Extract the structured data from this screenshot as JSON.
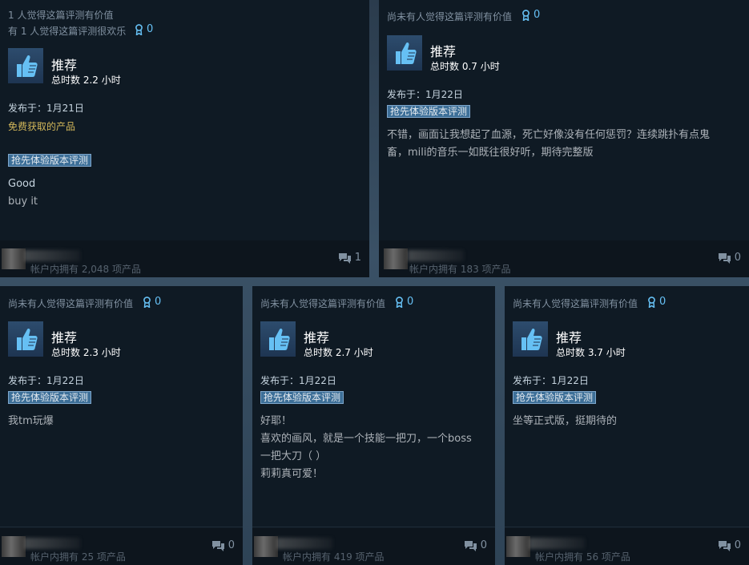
{
  "reviews": [
    {
      "helpful_line1": "1 人觉得这篇评测有价值",
      "helpful_line2": "有 1 人觉得这篇评测很欢乐",
      "award_count": "0",
      "verdict": "推荐",
      "hours": "总时数 2.2 小时",
      "posted": "发布于：1月21日",
      "free_label": "免费获取的产品",
      "early_access": "抢先体验版本评测",
      "body": [
        "Good",
        "buy it"
      ],
      "owned": "帐户内拥有 2,048 项产品",
      "comment_count": "1"
    },
    {
      "helpful_line1": "尚未有人觉得这篇评测有价值",
      "award_count": "0",
      "verdict": "推荐",
      "hours": "总时数 0.7 小时",
      "posted": "发布于：1月22日",
      "early_access": "抢先体验版本评测",
      "body": [
        "不错，画面让我想起了血源，死亡好像没有任何惩罚？连续跳扑有点鬼",
        "畜，mili的音乐一如既往很好听，期待完整版"
      ],
      "owned": "帐户内拥有 183 项产品",
      "comment_count": "0"
    },
    {
      "helpful_line1": "尚未有人觉得这篇评测有价值",
      "award_count": "0",
      "verdict": "推荐",
      "hours": "总时数 2.3 小时",
      "posted": "发布于：1月22日",
      "early_access": "抢先体验版本评测",
      "body": [
        "我tm玩爆"
      ],
      "owned": "帐户内拥有 25 项产品",
      "comment_count": "0"
    },
    {
      "helpful_line1": "尚未有人觉得这篇评测有价值",
      "award_count": "0",
      "verdict": "推荐",
      "hours": "总时数 2.7 小时",
      "posted": "发布于：1月22日",
      "early_access": "抢先体验版本评测",
      "body": [
        "好耶！",
        "喜欢的画风，就是一个技能一把刀，一个boss",
        "一把大刀（ ）",
        "莉莉真可爱！"
      ],
      "owned": "帐户内拥有 419 项产品",
      "comment_count": "0"
    },
    {
      "helpful_line1": "尚未有人觉得这篇评测有价值",
      "award_count": "0",
      "verdict": "推荐",
      "hours": "总时数 3.7 小时",
      "posted": "发布于：1月22日",
      "early_access": "抢先体验版本评测",
      "body": [
        "坐等正式版，挺期待的"
      ],
      "owned": "帐户内拥有 56 项产品",
      "comment_count": "0"
    }
  ],
  "colors": {
    "card_bg": "#0f1a24",
    "accent_blue": "#66c0f4",
    "free_gold": "#d2b75a",
    "early_access_bg": "#3d6f98"
  },
  "icons": {
    "award": "award-icon",
    "thumb": "thumbs-up-icon",
    "comment": "comment-icon"
  }
}
